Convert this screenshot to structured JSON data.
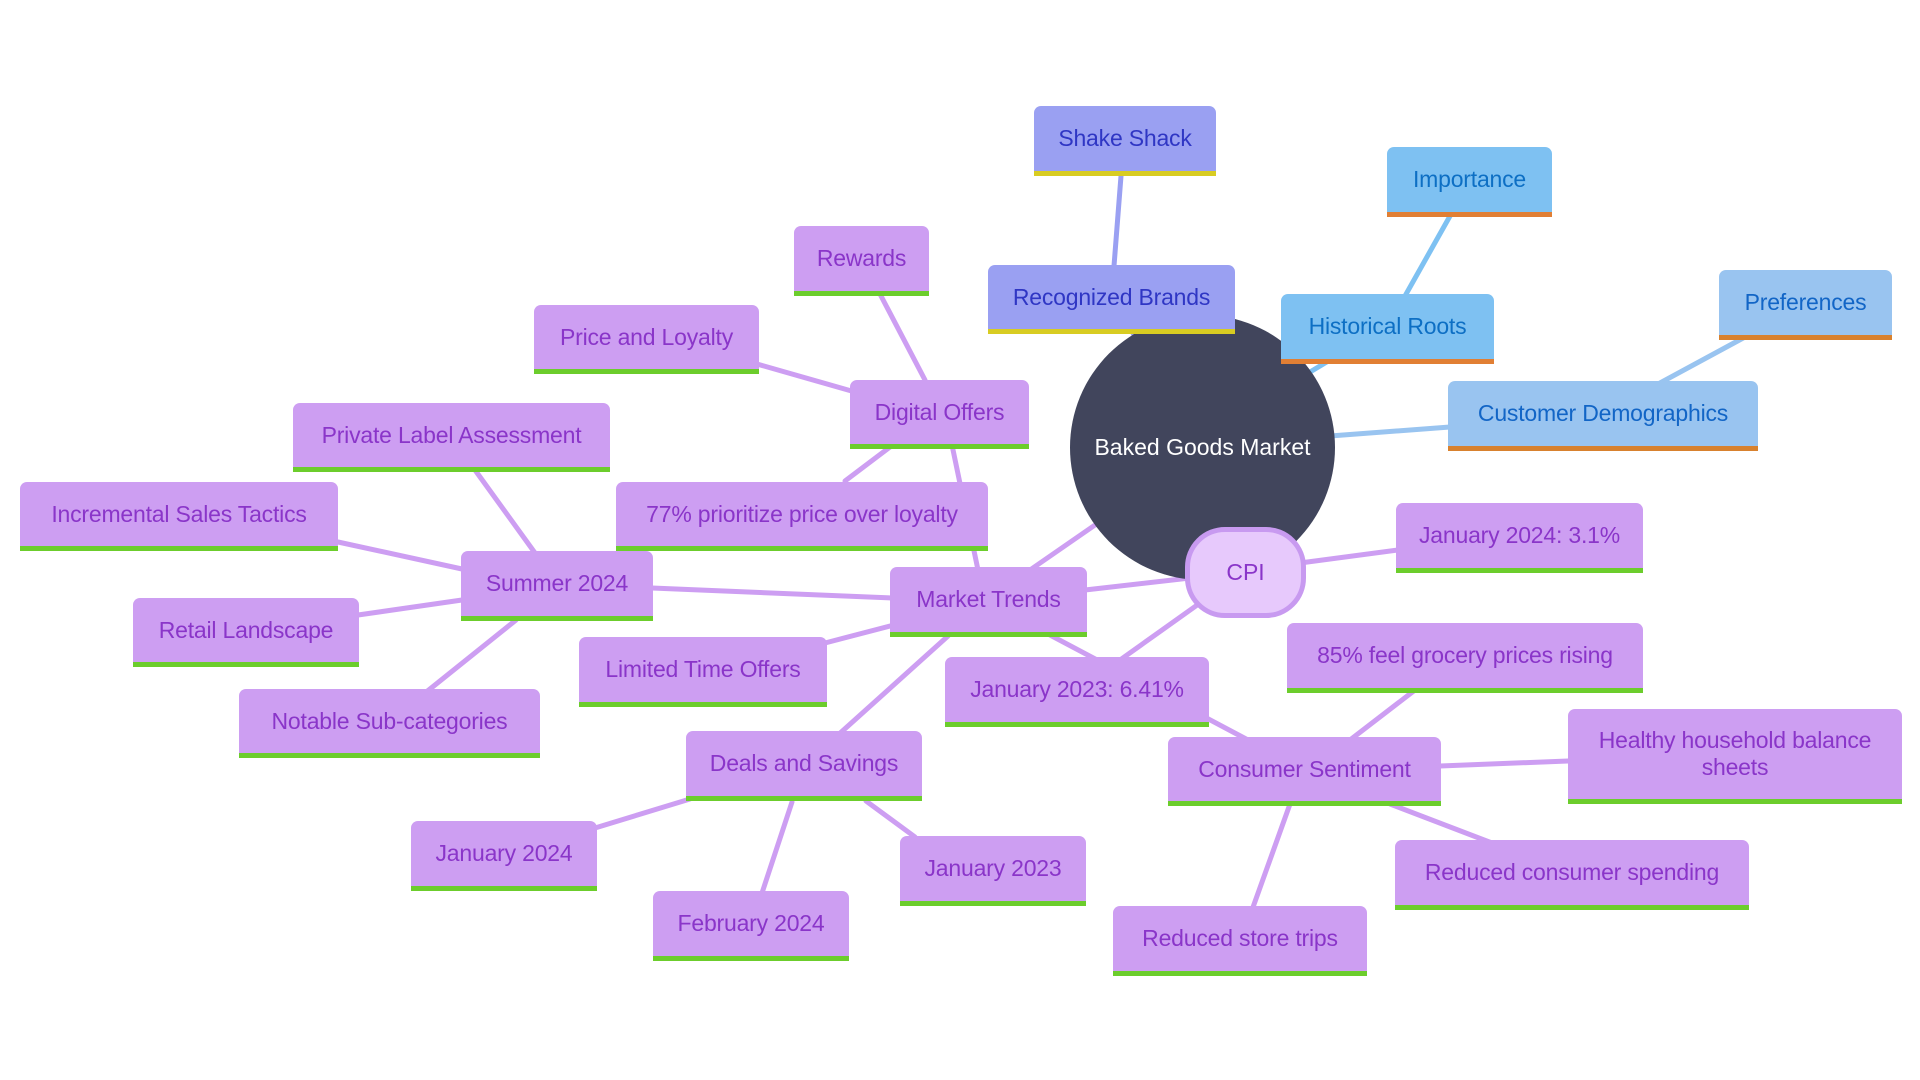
{
  "root": {
    "label": "Baked Goods Market"
  },
  "nodes": {
    "shake_shack": "Shake Shack",
    "recognized_brands": "Recognized Brands",
    "importance": "Importance",
    "historical_roots": "Historical Roots",
    "preferences": "Preferences",
    "customer_demographics": "Customer Demographics",
    "rewards": "Rewards",
    "price_and_loyalty": "Price and Loyalty",
    "digital_offers": "Digital Offers",
    "private_label_assessment": "Private Label Assessment",
    "incremental_sales_tactics": "Incremental Sales Tactics",
    "prioritize_price": "77% prioritize price over loyalty",
    "summer_2024": "Summer 2024",
    "market_trends": "Market Trends",
    "cpi": "CPI",
    "jan_2024_cpi": "January 2024: 3.1%",
    "retail_landscape": "Retail Landscape",
    "limited_time_offers": "Limited Time Offers",
    "jan_2023_cpi": "January 2023: 6.41%",
    "grocery_prices_rising": "85% feel grocery prices rising",
    "notable_subcategories": "Notable Sub-categories",
    "deals_and_savings": "Deals and Savings",
    "consumer_sentiment": "Consumer Sentiment",
    "healthy_balance_sheets": "Healthy household balance sheets",
    "jan_2024": "January 2024",
    "jan_2023": "January 2023",
    "reduced_spending": "Reduced consumer spending",
    "feb_2024": "February 2024",
    "reduced_trips": "Reduced store trips"
  },
  "colors": {
    "root_fill": "#41455c",
    "purple_fill": "#cd9ef2",
    "purple_text": "#8a35c9",
    "purple_accent": "#6ccd2c",
    "indigo_fill": "#9aa0f2",
    "indigo_text": "#2f36c4",
    "indigo_accent": "#d8cc22",
    "sky_fill": "#7ec1f2",
    "sky_text": "#0d6fc4",
    "blue_accent": "#e17f34",
    "lightblue_fill": "#99c4f0",
    "cpi_fill": "#e7c9fc"
  }
}
